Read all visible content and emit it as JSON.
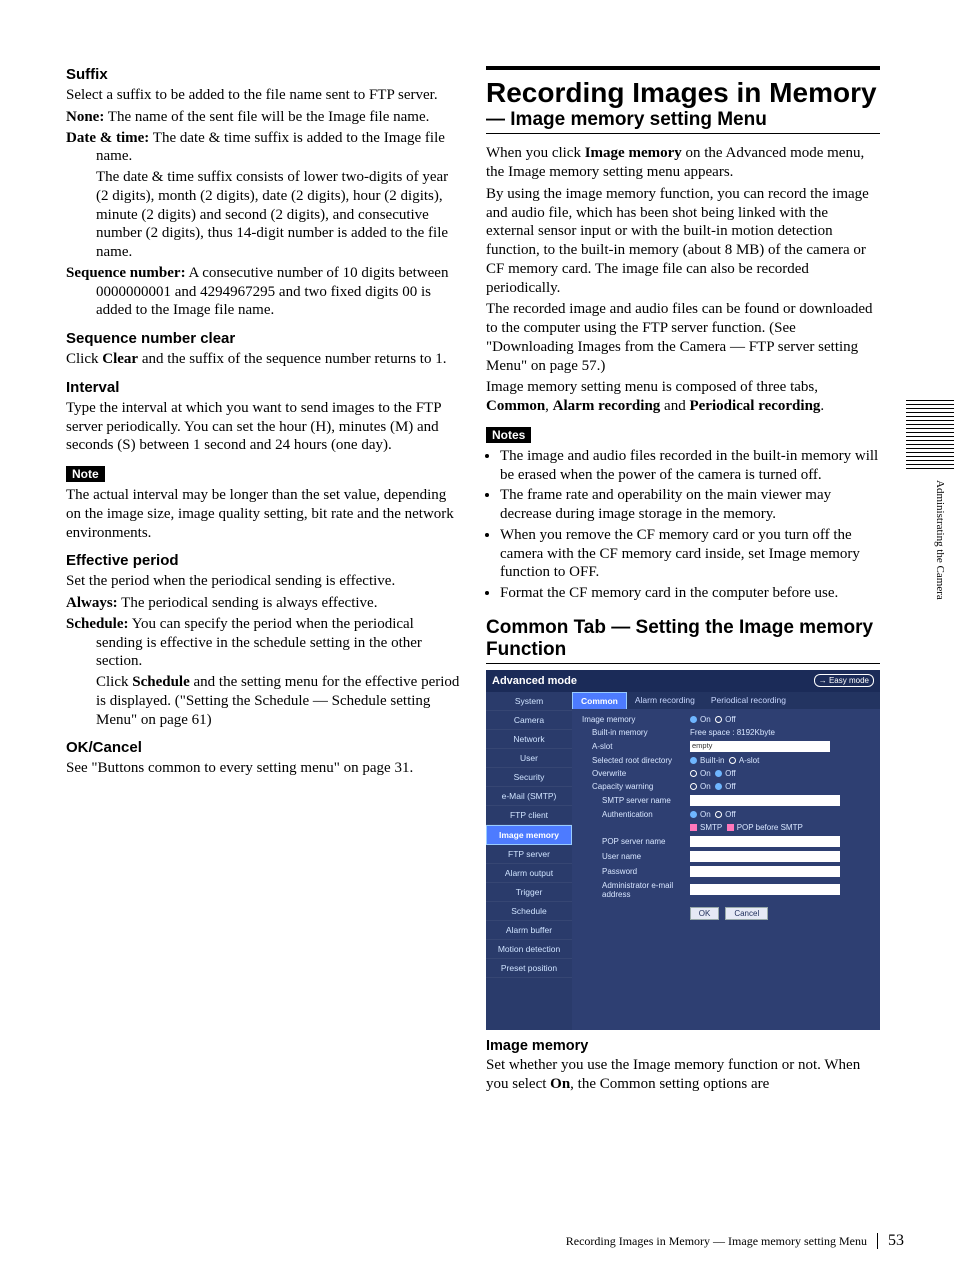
{
  "sideLabel": "Administrating the Camera",
  "footer": {
    "title": "Recording Images in Memory — Image memory setting Menu",
    "page": "53"
  },
  "left": {
    "suffix": {
      "heading": "Suffix",
      "intro": "Select a suffix to be added to the file name sent to FTP server.",
      "none": {
        "term": "None:",
        "text": " The name of the sent file will be the Image file name."
      },
      "dt": {
        "term": "Date & time:",
        "text": " The date & time suffix is added to the Image file name.",
        "detail": "The date & time suffix consists of lower two-digits of year (2 digits), month (2 digits), date (2 digits), hour (2 digits), minute (2 digits) and second (2 digits), and consecutive number (2 digits), thus 14-digit number is added to the file name."
      },
      "seq": {
        "term": "Sequence number:",
        "text": " A consecutive number of 10 digits between 0000000001 and 4294967295 and two fixed digits 00 is added to the Image file name."
      }
    },
    "seqclear": {
      "heading": "Sequence number clear",
      "p1": "Click ",
      "b1": "Clear",
      "p2": " and the suffix of the sequence number returns to 1."
    },
    "interval": {
      "heading": "Interval",
      "text": "Type the interval at which you want to send images to the FTP server periodically. You can set the hour (H), minutes (M) and seconds (S) between 1 second and 24 hours (one day)."
    },
    "note": {
      "label": "Note",
      "text": "The actual interval may be longer than the set value, depending on the image size, image quality setting, bit rate and the network environments."
    },
    "effective": {
      "heading": "Effective period",
      "intro": "Set the period when the periodical sending is effective.",
      "always": {
        "term": "Always:",
        "text": " The periodical sending is always effective."
      },
      "sched": {
        "term": "Schedule:",
        "text": " You can specify the period when the periodical sending is effective in the schedule setting in the other section.",
        "d1": "Click ",
        "d1b": "Schedule",
        "d2": " and the setting menu for the effective period is displayed. (\"Setting the Schedule — Schedule setting Menu\" on page 61)"
      }
    },
    "okcancel": {
      "heading": "OK/Cancel",
      "text": "See \"Buttons common to every setting menu\" on page 31."
    }
  },
  "right": {
    "h1": "Recording Images in Memory",
    "h2": "— Image memory setting Menu",
    "p1a": "When you click ",
    "p1b": "Image memory",
    "p1c": " on the Advanced mode menu, the Image memory setting menu appears.",
    "p2": "By using the image memory function, you can record the image and audio file, which has been shot being linked with the external sensor input or with the built-in motion detection function, to the built-in memory (about 8 MB) of the camera or CF memory card. The image file can also be recorded periodically.",
    "p3": "The recorded image and audio files can be found or downloaded to the computer using the FTP server function. (See \"Downloading Images from the Camera — FTP server setting Menu\" on page 57.)",
    "p4a": "Image memory setting menu is composed of three tabs, ",
    "p4b": "Common",
    "p4c": ", ",
    "p4d": "Alarm recording",
    "p4e": " and ",
    "p4f": "Periodical recording",
    "p4g": ".",
    "notesLabel": "Notes",
    "notes": [
      "The image and audio files recorded in the built-in memory will be erased when the power of the camera is turned off.",
      "The frame rate and operability on the main viewer may decrease during image storage in the memory.",
      "When you remove the CF memory card or you turn off the camera with the CF memory card inside, set Image memory function to OFF.",
      "Format the CF memory card in the computer before use."
    ],
    "h2section": "Common Tab — Setting the Image memory Function",
    "shot": {
      "header": "Advanced mode",
      "easy": "→ Easy mode",
      "side": [
        "System",
        "Camera",
        "Network",
        "User",
        "Security",
        "e-Mail (SMTP)",
        "FTP client",
        "Image memory",
        "FTP server",
        "Alarm output",
        "Trigger",
        "Schedule",
        "Alarm buffer",
        "Motion detection",
        "Preset position"
      ],
      "sideActiveIndex": 7,
      "tabs": [
        "Common",
        "Alarm recording",
        "Periodical recording"
      ],
      "tabActiveIndex": 0,
      "form": {
        "imgmem": {
          "label": "Image memory",
          "on": "On",
          "off": "Off"
        },
        "builtin": {
          "label": "Built-in memory",
          "value": "Free space : 8192Kbyte"
        },
        "aslot": {
          "label": "A-slot",
          "value": "empty"
        },
        "selroot": {
          "label": "Selected root directory",
          "opt1": "Built-in",
          "opt2": "A-slot"
        },
        "overwrite": {
          "label": "Overwrite",
          "on": "On",
          "off": "Off"
        },
        "capw": {
          "label": "Capacity warning",
          "on": "On",
          "off": "Off"
        },
        "smtp": {
          "label": "SMTP server name"
        },
        "auth": {
          "label": "Authentication",
          "on": "On",
          "off": "Off"
        },
        "authopts": {
          "opt1": "SMTP",
          "opt2": "POP before SMTP"
        },
        "pop": {
          "label": "POP server name"
        },
        "user": {
          "label": "User name"
        },
        "pass": {
          "label": "Password"
        },
        "admin": {
          "label": "Administrator e-mail address"
        },
        "ok": "OK",
        "cancel": "Cancel"
      }
    },
    "h4": "Image memory",
    "p5a": "Set whether you use the Image memory function or not. When you select ",
    "p5b": "On",
    "p5c": ", the Common setting options are"
  }
}
